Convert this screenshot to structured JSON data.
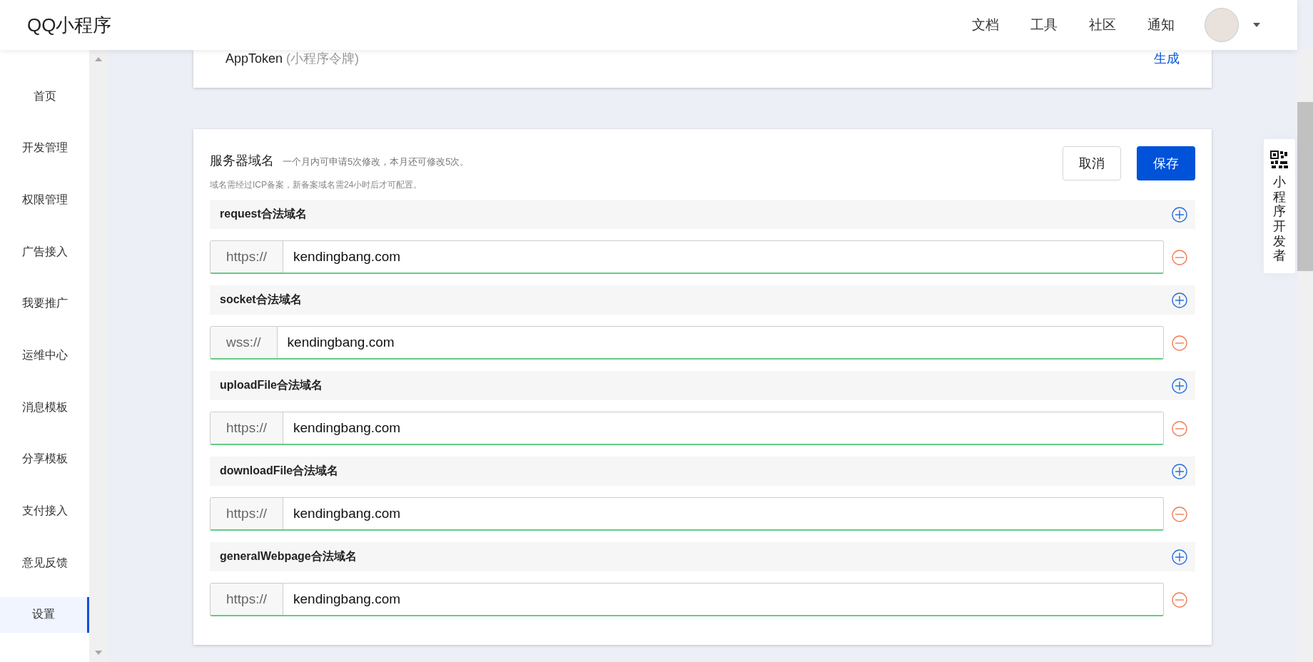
{
  "header": {
    "logo": "QQ小程序",
    "nav": [
      "文档",
      "工具",
      "社区",
      "通知"
    ]
  },
  "sidebar": {
    "items": [
      {
        "label": "首页",
        "selected": false
      },
      {
        "label": "开发管理",
        "selected": false
      },
      {
        "label": "权限管理",
        "selected": false
      },
      {
        "label": "广告接入",
        "selected": false
      },
      {
        "label": "我要推广",
        "selected": false
      },
      {
        "label": "运维中心",
        "selected": false
      },
      {
        "label": "消息模板",
        "selected": false
      },
      {
        "label": "分享模板",
        "selected": false
      },
      {
        "label": "支付接入",
        "selected": false
      },
      {
        "label": "意见反馈",
        "selected": false
      },
      {
        "label": "设置",
        "selected": true
      }
    ]
  },
  "token_card": {
    "label": "AppToken",
    "note": "(小程序令牌)",
    "action": "生成"
  },
  "domain_card": {
    "title": "服务器域名",
    "quota": "一个月内可申请5次修改，本月还可修改5次。",
    "hint": "域名需经过ICP备案，新备案域名需24小时后才可配置。",
    "cancel": "取消",
    "save": "保存",
    "sections": [
      {
        "title": "request合法域名",
        "prefix": "https://",
        "value": "kendingbang.com"
      },
      {
        "title": "socket合法域名",
        "prefix": "wss://",
        "value": "kendingbang.com"
      },
      {
        "title": "uploadFile合法域名",
        "prefix": "https://",
        "value": "kendingbang.com"
      },
      {
        "title": "downloadFile合法域名",
        "prefix": "https://",
        "value": "kendingbang.com"
      },
      {
        "title": "generalWebpage合法域名",
        "prefix": "https://",
        "value": "kendingbang.com"
      }
    ]
  },
  "side_panel": {
    "label": "小程序开发者"
  }
}
